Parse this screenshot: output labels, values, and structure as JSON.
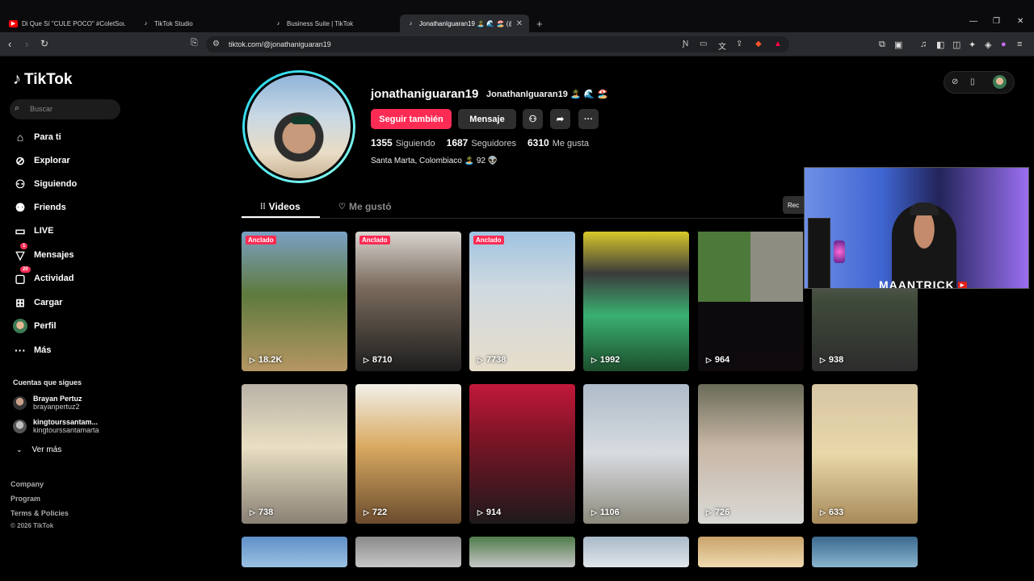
{
  "browser": {
    "tabs": [
      {
        "title": "Di Que Sí \"CULE POCO\" #ColetSound",
        "favicon": "youtube-icon",
        "color": "#ff0000",
        "active": false
      },
      {
        "title": "TikTok Studio",
        "favicon": "tiktok-icon",
        "color": "#ffffff",
        "active": false
      },
      {
        "title": "Business Suite | TikTok",
        "favicon": "tiktok-icon",
        "color": "#ffffff",
        "active": false
      },
      {
        "title": "JonathanIguaran19 🏝️ 🌊 🏖️ (@",
        "favicon": "tiktok-icon",
        "color": "#ffffff",
        "active": true
      }
    ],
    "url": "tiktok.com/@jonathaniguaran19"
  },
  "sidebar": {
    "logo": "TikTok",
    "search_placeholder": "Buscar",
    "nav": [
      {
        "label": "Para ti",
        "icon": "home-icon",
        "glyph": "⌂"
      },
      {
        "label": "Explorar",
        "icon": "compass-icon",
        "glyph": "⊘"
      },
      {
        "label": "Siguiendo",
        "icon": "person-icon",
        "glyph": "⚇"
      },
      {
        "label": "Friends",
        "icon": "friends-icon",
        "glyph": "⚉"
      },
      {
        "label": "LIVE",
        "icon": "live-icon",
        "glyph": "▭"
      },
      {
        "label": "Mensajes",
        "icon": "send-icon",
        "glyph": "▽",
        "badge": "1"
      },
      {
        "label": "Actividad",
        "icon": "inbox-icon",
        "glyph": "▢",
        "badge": "20"
      },
      {
        "label": "Cargar",
        "icon": "upload-icon",
        "glyph": "⊞"
      },
      {
        "label": "Perfil",
        "icon": "avatar-icon",
        "glyph": "●"
      },
      {
        "label": "Más",
        "icon": "more-icon",
        "glyph": "···"
      }
    ],
    "following_title": "Cuentas que sigues",
    "following": [
      {
        "name": "Brayan Pertuz",
        "handle": "brayanpertuz2"
      },
      {
        "name": "kingtourssantam...",
        "handle": "kingtourssantamarta"
      }
    ],
    "see_more": "Ver más",
    "footer": [
      "Company",
      "Program",
      "Terms & Policies"
    ],
    "copyright": "© 2026 TikTok"
  },
  "profile": {
    "username": "jonathaniguaran19",
    "nickname": "JonathanIguaran19 🏝️ 🌊 🏖️",
    "follow_button": "Seguir también",
    "message_button": "Mensaje",
    "stats": {
      "following": "1355",
      "following_label": "Siguiendo",
      "followers": "1687",
      "followers_label": "Seguidores",
      "likes": "6310",
      "likes_label": "Me gusta"
    },
    "bio": "Santa Marta, Colombiaco 🏝️ 92 👽",
    "tab_videos": "Videos",
    "tab_liked": "Me gustó",
    "recent_button": "Rec"
  },
  "videos": [
    {
      "views": "18.2K",
      "pinned": true,
      "bg": "linear-gradient(180deg,#7aa0c4 0%,#5e7a3d 45%,#b59663 100%)"
    },
    {
      "views": "8710",
      "pinned": true,
      "bg": "linear-gradient(180deg,#d8d4cf 0%,#7a6a5c 40%,#1d1d1d 100%)"
    },
    {
      "views": "7738",
      "pinned": true,
      "bg": "linear-gradient(180deg,#9fc3e0 0%,#cfd9e0 40%,#e7ddca 100%)"
    },
    {
      "views": "1992",
      "pinned": false,
      "bg": "linear-gradient(180deg,#d8c82a 0%,#3b3b3b 30%,#3ab070 60%,#1c4e2c 100%)"
    },
    {
      "views": "964",
      "pinned": false,
      "bg": "linear-gradient(180deg,#0a0a0a 0%,#0e0a0e 100%)"
    },
    {
      "views": "938",
      "pinned": false,
      "bg": "linear-gradient(180deg,#7d7b7d 0%,#3f4a3a 50%,#2c2c2c 100%)"
    },
    {
      "views": "738",
      "pinned": false,
      "bg": "linear-gradient(180deg,#b9b2a6 0%,#e9dfc3 45%,#8a8175 100%)"
    },
    {
      "views": "722",
      "pinned": false,
      "bg": "linear-gradient(180deg,#f2f0ea 0%,#d9a960 45%,#6b4c2e 100%)"
    },
    {
      "views": "914",
      "pinned": false,
      "bg": "linear-gradient(180deg,#c2183a 0%,#7a1425 40%,#1e1a1c 100%)"
    },
    {
      "views": "1106",
      "pinned": false,
      "bg": "linear-gradient(180deg,#aebbc9 0%,#d8dce0 50%,#8d8a7d 100%)"
    },
    {
      "views": "726",
      "pinned": false,
      "bg": "linear-gradient(180deg,#6b6b58 0%,#c8b7a6 45%,#d9d9d6 100%)"
    },
    {
      "views": "633",
      "pinned": false,
      "bg": "linear-gradient(180deg,#d7c5a5 0%,#e8d8a8 50%,#a88a5a 100%)"
    },
    {
      "views": "",
      "pinned": false,
      "bg": "linear-gradient(180deg,#5f8fc7 0%,#9bc1e3 100%)"
    },
    {
      "views": "",
      "pinned": false,
      "bg": "linear-gradient(180deg,#8a8a8a 0%,#c7c7c7 100%)"
    },
    {
      "views": "",
      "pinned": false,
      "bg": "linear-gradient(180deg,#4f7b4a 0%,#c7c7c7 100%)"
    },
    {
      "views": "",
      "pinned": false,
      "bg": "linear-gradient(180deg,#a9b9c9 0%,#e0e6ea 100%)"
    },
    {
      "views": "",
      "pinned": false,
      "bg": "linear-gradient(180deg,#c9a26a 0%,#eedbb0 100%)"
    },
    {
      "views": "",
      "pinned": false,
      "bg": "linear-gradient(180deg,#3b6a8e 0%,#8ab5cf 100%)"
    }
  ],
  "pinned_label": "Anclado",
  "webcam": {
    "channel": "MAANTRICK",
    "yt_label": "▶"
  },
  "colors": {
    "accent": "#fe2c55",
    "ring": "#20d5ec"
  }
}
